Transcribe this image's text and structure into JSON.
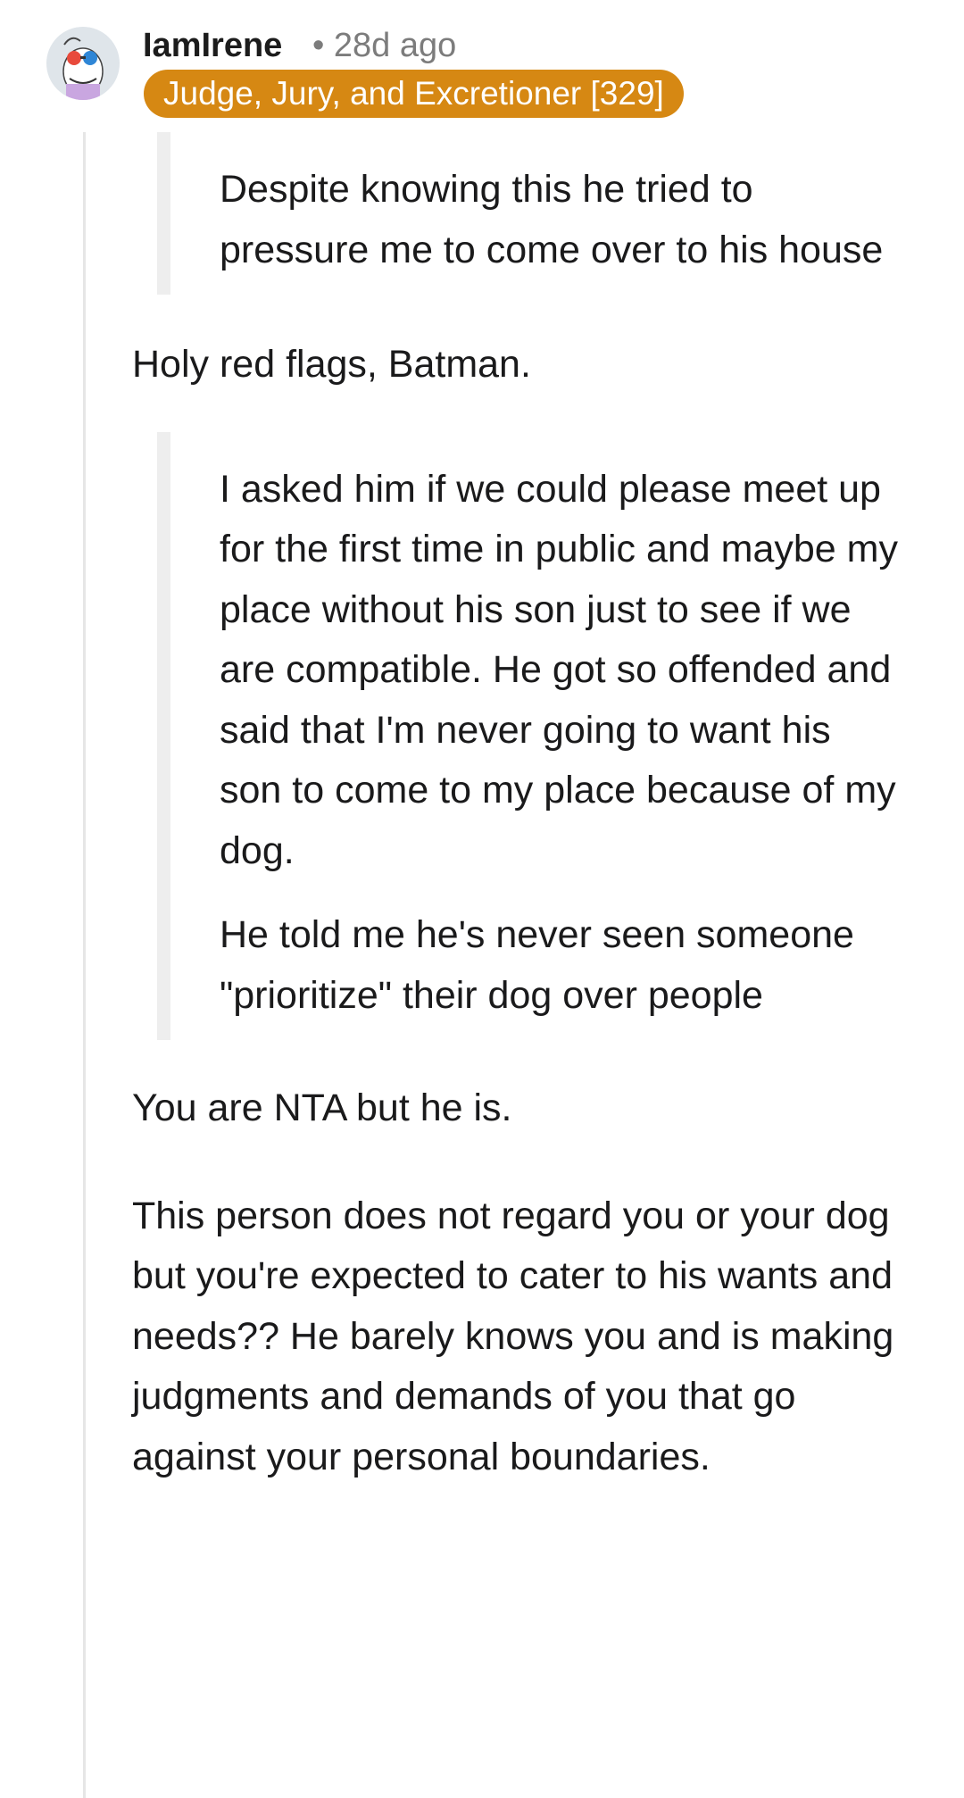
{
  "comment": {
    "author": "IamIrene",
    "separator": "•",
    "age": "28d ago",
    "flair": "Judge, Jury, and Excretioner [329]",
    "quote1": {
      "p1": "Despite knowing this he tried to pressure me to come over to his house"
    },
    "text1": "Holy red flags, Batman.",
    "quote2": {
      "p1": "I asked him if we could please meet up for the first time in public and maybe my place without his son just to see if we are compatible. He got so offended and said that I'm never going to want his son to come to my place because of my dog.",
      "p2": "He told me he's never seen someone \"prioritize\" their dog over people"
    },
    "text2": "You are NTA but he is.",
    "text3": "This person does not regard you or your dog but you're expected to cater to his wants and needs?? He barely knows you and is making judgments and demands of you that go against your personal boundaries."
  },
  "colors": {
    "flair_bg": "#d68813",
    "meta_text": "#7c7c7c",
    "quote_bar": "#eeeeee",
    "thread_line": "#e6e6e6"
  },
  "icons": {
    "avatar": "snoo-avatar-icon"
  }
}
